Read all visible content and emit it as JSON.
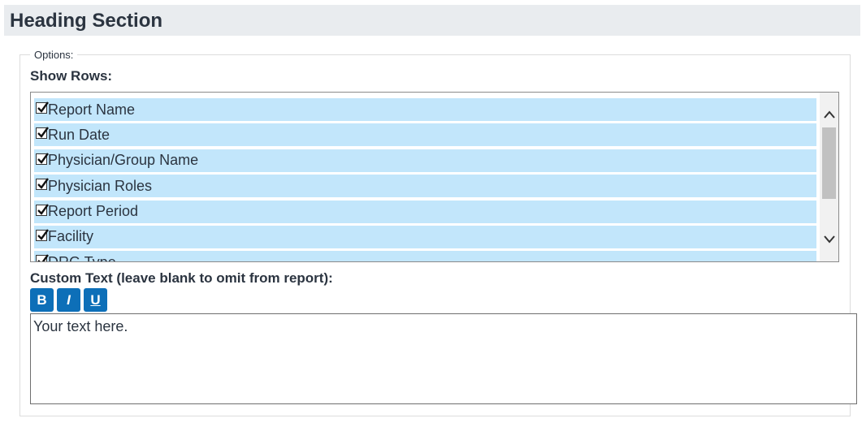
{
  "heading": {
    "title": "Heading Section"
  },
  "options": {
    "legend": "Options:",
    "show_rows_label": "Show Rows:",
    "rows": [
      {
        "label": "Report Name",
        "checked": true
      },
      {
        "label": "Run Date",
        "checked": true
      },
      {
        "label": "Physician/Group Name",
        "checked": true
      },
      {
        "label": "Physician Roles",
        "checked": true
      },
      {
        "label": "Report Period",
        "checked": true
      },
      {
        "label": "Facility",
        "checked": true
      },
      {
        "label": "DRG Type",
        "checked": true
      }
    ],
    "custom_text_label": "Custom Text (leave blank to omit from report):",
    "toolbar": {
      "bold_label": "B",
      "italic_label": "I",
      "underline_label": "U"
    },
    "custom_text_value": "Your text here."
  },
  "colors": {
    "row_highlight": "#c2e6fb",
    "button_blue": "#0d6fb8",
    "heading_bg": "#e9ecef"
  }
}
